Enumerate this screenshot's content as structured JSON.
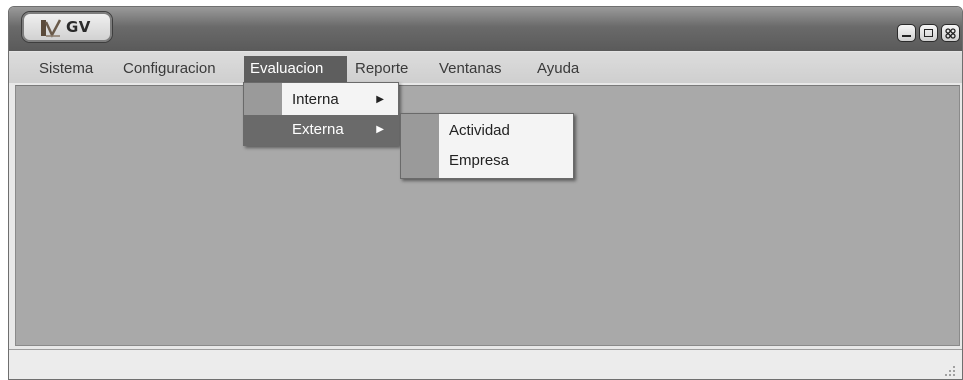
{
  "app": {
    "title": "GV",
    "logo_icon": "gv-logo-icon"
  },
  "window_controls": {
    "minimize_icon": "minimize-icon",
    "maximize_icon": "maximize-icon",
    "close_icon": "close-icon"
  },
  "menubar": {
    "items": [
      {
        "label": "Sistema"
      },
      {
        "label": "Configuracion"
      },
      {
        "label": "Evaluacion",
        "active": true
      },
      {
        "label": "Reporte"
      },
      {
        "label": "Ventanas"
      },
      {
        "label": "Ayuda"
      }
    ]
  },
  "evaluacion_menu": {
    "items": [
      {
        "label": "Interna",
        "submenu_icon": "chevron-right-icon"
      },
      {
        "label": "Externa",
        "submenu_icon": "chevron-right-icon",
        "highlighted": true
      }
    ]
  },
  "externa_submenu": {
    "items": [
      {
        "label": "Actividad"
      },
      {
        "label": "Empresa"
      }
    ]
  },
  "colors": {
    "menu_active_bg": "#5e5e5e",
    "workspace_bg": "#a9a9a9",
    "menu_gutter": "#9a9a9a"
  }
}
